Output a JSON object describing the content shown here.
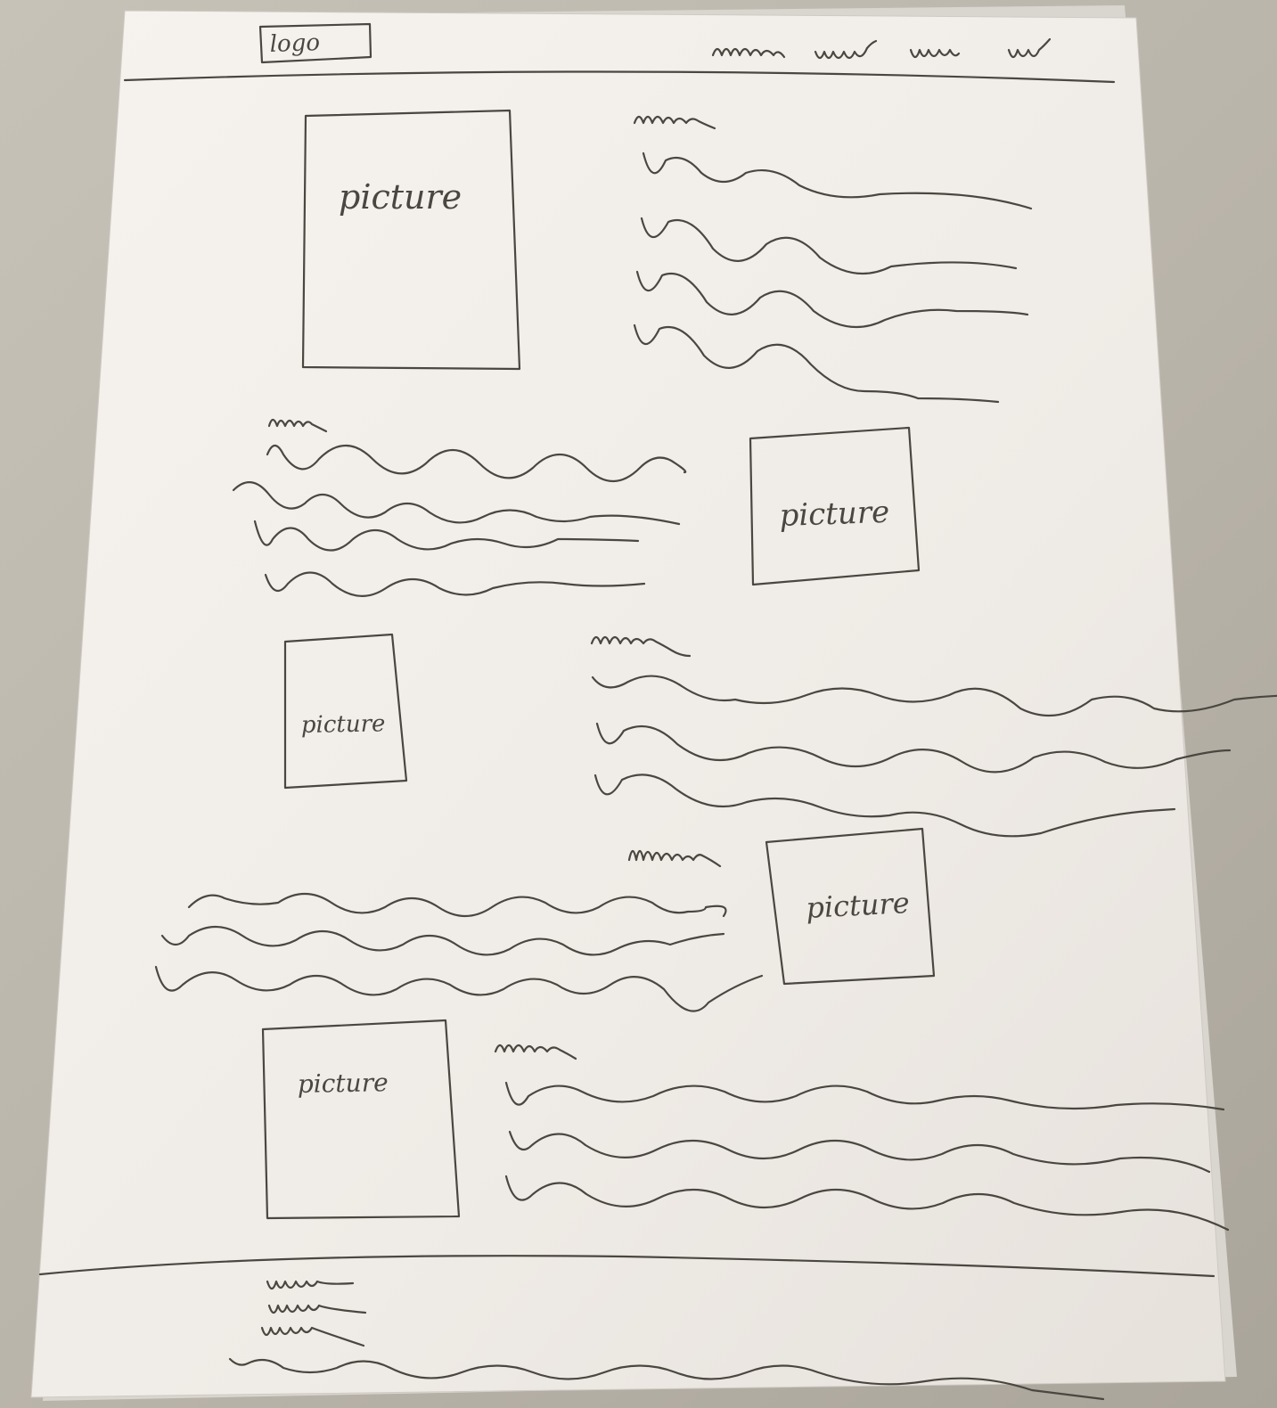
{
  "header": {
    "logo_label": "logo"
  },
  "sections": [
    {
      "picture_label": "picture"
    },
    {
      "picture_label": "picture"
    },
    {
      "picture_label": "picture"
    },
    {
      "picture_label": "picture"
    },
    {
      "picture_label": "picture"
    }
  ],
  "colors": {
    "pencil": "#4a4640",
    "paper": "#f3efe9",
    "background": "#bdb8ae"
  }
}
